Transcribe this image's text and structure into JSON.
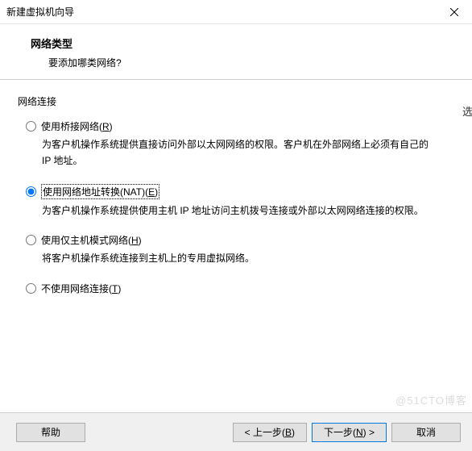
{
  "titlebar": {
    "title": "新建虚拟机向导"
  },
  "header": {
    "heading": "网络类型",
    "subheading": "要添加哪类网络?"
  },
  "group": {
    "label": "网络连接"
  },
  "options": {
    "bridged": {
      "label_pre": "使用桥接网络(",
      "mn": "R",
      "label_post": ")",
      "desc": "为客户机操作系统提供直接访问外部以太网网络的权限。客户机在外部网络上必须有自己的 IP 地址。"
    },
    "nat": {
      "label_pre": "使用网络地址转换(NAT)(",
      "mn": "E",
      "label_post": ")",
      "desc": "为客户机操作系统提供使用主机 IP 地址访问主机拨号连接或外部以太网网络连接的权限。"
    },
    "host": {
      "label_pre": "使用仅主机模式网络(",
      "mn": "H",
      "label_post": ")",
      "desc": "将客户机操作系统连接到主机上的专用虚拟网络。"
    },
    "none": {
      "label_pre": "不使用网络连接(",
      "mn": "T",
      "label_post": ")"
    }
  },
  "buttons": {
    "help": "帮助",
    "back_pre": "< 上一步(",
    "back_mn": "B",
    "back_post": ")",
    "next_pre": "下一步(",
    "next_mn": "N",
    "next_post": ") >",
    "cancel": "取消"
  },
  "watermark": "@51CTO博客",
  "side_hint": "选"
}
